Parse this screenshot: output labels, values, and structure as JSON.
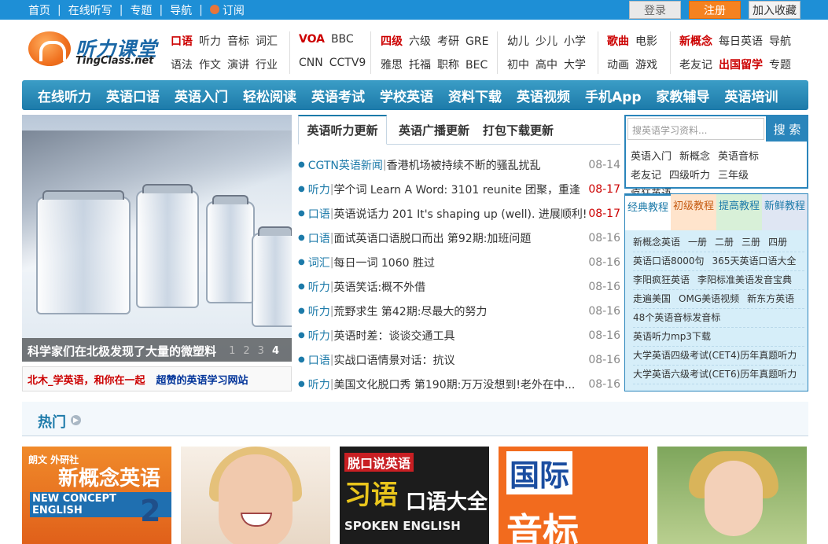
{
  "topbar": {
    "links": [
      "首页",
      "在线听写",
      "专题",
      "导航"
    ],
    "subscribe": "订阅",
    "login": "登录",
    "register": "注册",
    "favorite": "加入收藏"
  },
  "logo": {
    "cn": "听力课堂",
    "en": "TingClass.net"
  },
  "categories": {
    "g1_row1": [
      "口语",
      "听力",
      "音标",
      "词汇"
    ],
    "g1_row2": [
      "语法",
      "作文",
      "演讲",
      "行业"
    ],
    "g2_row1": [
      "VOA",
      "BBC"
    ],
    "g2_row2": [
      "CNN",
      "CCTV9"
    ],
    "g3_row1": [
      "四级",
      "六级",
      "考研",
      "GRE"
    ],
    "g3_row2": [
      "雅思",
      "托福",
      "职称",
      "BEC"
    ],
    "g4_row1": [
      "幼儿",
      "少儿",
      "小学"
    ],
    "g4_row2": [
      "初中",
      "高中",
      "大学"
    ],
    "g5_row1": [
      "歌曲",
      "电影"
    ],
    "g5_row2": [
      "动画",
      "游戏"
    ],
    "g6_row1": [
      "新概念",
      "每日英语",
      "导航"
    ],
    "g6_row2": [
      "老友记",
      "出国留学",
      "专题"
    ]
  },
  "mainnav": [
    "在线听力",
    "英语口语",
    "英语入门",
    "轻松阅读",
    "英语考试",
    "学校英语",
    "资料下载",
    "英语视频",
    "手机App",
    "家教辅导",
    "英语培训"
  ],
  "slideshow": {
    "caption": "科学家们在北极发现了大量的微塑料",
    "dots": [
      "1",
      "2",
      "3",
      "4"
    ],
    "link1": "北木_学英语，和你在一起",
    "link2": "超赞的英语学习网站"
  },
  "updates": {
    "tabs": [
      "英语听力更新",
      "英语广播更新",
      "打包下载更新"
    ],
    "items": [
      {
        "tag": "CGTN英语新闻",
        "title": "香港机场被持续不断的骚乱扰乱",
        "date": "08-14"
      },
      {
        "tag": "听力",
        "title": "学个词 Learn A Word: 3101 reunite 团聚，重逢",
        "date": "08-17"
      },
      {
        "tag": "口语",
        "title": "英语说话力 201 It's shaping up (well). 进展顺利!",
        "date": "08-17"
      },
      {
        "tag": "口语",
        "title": "面试英语口语脱口而出 第92期:加班问题",
        "date": "08-16"
      },
      {
        "tag": "词汇",
        "title": "每日一词 1060 胜过",
        "date": "08-16"
      },
      {
        "tag": "听力",
        "title": "英语笑话:概不外借",
        "date": "08-16"
      },
      {
        "tag": "听力",
        "title": "荒野求生 第42期:尽最大的努力",
        "date": "08-16"
      },
      {
        "tag": "听力",
        "title": "英语时差：谈谈交通工具",
        "date": "08-16"
      },
      {
        "tag": "口语",
        "title": "实战口语情景对话：抗议",
        "date": "08-16"
      },
      {
        "tag": "听力",
        "title": "美国文化脱口秀 第190期:万万没想到!老外在中...",
        "date": "08-16"
      }
    ]
  },
  "search": {
    "placeholder": "搜英语学习资料...",
    "button": "搜 索",
    "keywords": [
      "英语入门",
      "新概念",
      "英语音标",
      "老友记",
      "四级听力",
      "三年级",
      "疯狂英语"
    ]
  },
  "tutorials": {
    "tabs": [
      "经典教程",
      "初级教程",
      "提高教程",
      "新鲜教程"
    ],
    "rows": [
      [
        "新概念英语",
        "一册",
        "二册",
        "三册",
        "四册"
      ],
      [
        "英语口语8000句",
        "365天英语口语大全"
      ],
      [
        "李阳疯狂英语",
        "李阳标准美语发音宝典"
      ],
      [
        "走遍美国",
        "OMG美语视频",
        "新东方英语"
      ],
      [
        "48个英语音标发音标"
      ],
      [
        "英语听力mp3下载"
      ],
      [
        "大学英语四级考试(CET4)历年真题听力"
      ],
      [
        "大学英语六级考试(CET6)历年真题听力"
      ]
    ]
  },
  "hot": {
    "title": "热门"
  },
  "thumbs": {
    "t1": {
      "publisher": "朗文 外研社",
      "title": "新概念英语",
      "subtitle": "NEW CONCEPT ENGLISH",
      "num": "2"
    },
    "t3": {
      "badge": "脱口说英语",
      "big": "习语",
      "big2": "口语大全",
      "en": "SPOKEN ENGLISH"
    },
    "t4": {
      "top": "国际",
      "bottom": "音标"
    }
  }
}
